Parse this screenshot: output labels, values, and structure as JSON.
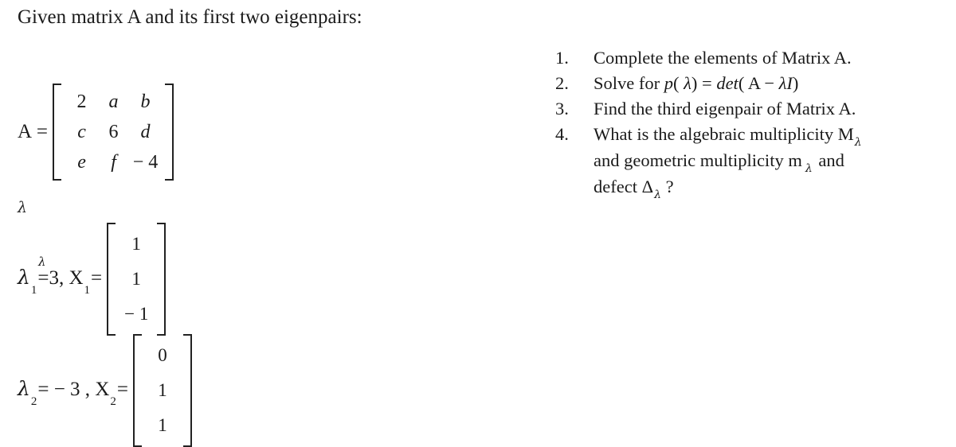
{
  "heading": "Given matrix A and its first two eigenpairs:",
  "matrix": {
    "label": "A =",
    "rows": [
      [
        "2",
        "a",
        "b"
      ],
      [
        "c",
        "6",
        "d"
      ],
      [
        "e",
        "f",
        "− 4"
      ]
    ],
    "italic_cells": [
      [
        false,
        true,
        true
      ],
      [
        true,
        false,
        true
      ],
      [
        true,
        true,
        false
      ]
    ]
  },
  "stray_symbol": "λ",
  "eigenpairs": [
    {
      "lambda_symbol": "λ",
      "index": "1",
      "overset_symbol": "λ",
      "equals": "=3,",
      "vector_label": "X",
      "vector_index": "1",
      "vector_equals": "=",
      "vector": [
        "1",
        "1",
        "− 1"
      ]
    },
    {
      "lambda_symbol": "λ",
      "index": "2",
      "overset_symbol": "",
      "equals": "= − 3 ,",
      "vector_label": "X",
      "vector_index": "2",
      "vector_equals": "=",
      "vector": [
        "0",
        "1",
        "1"
      ]
    }
  ],
  "tasks": [
    {
      "number": "1.",
      "lines": [
        [
          {
            "t": "Complete the elements of Matrix A.",
            "style": "normal"
          }
        ]
      ]
    },
    {
      "number": "2.",
      "lines": [
        [
          {
            "t": "Solve for ",
            "style": "normal"
          },
          {
            "t": "p",
            "style": "italic"
          },
          {
            "t": "( ",
            "style": "normal"
          },
          {
            "t": "λ",
            "style": "italic"
          },
          {
            "t": ") = ",
            "style": "normal"
          },
          {
            "t": "det",
            "style": "italic"
          },
          {
            "t": "( A − ",
            "style": "normal"
          },
          {
            "t": "λI",
            "style": "italic"
          },
          {
            "t": ")",
            "style": "normal"
          }
        ]
      ]
    },
    {
      "number": "3.",
      "lines": [
        [
          {
            "t": "Find the third eigenpair of Matrix A.",
            "style": "normal"
          }
        ]
      ]
    },
    {
      "number": "4.",
      "lines": [
        [
          {
            "t": "What is the algebraic multiplicity M",
            "style": "normal"
          },
          {
            "t": "λ",
            "style": "subscript"
          }
        ],
        [
          {
            "t": "and geometric multiplicity m",
            "style": "normal"
          },
          {
            "t": "λ",
            "style": "subscript-spaced"
          },
          {
            "t": " and",
            "style": "normal"
          }
        ],
        [
          {
            "t": "defect Δ",
            "style": "normal"
          },
          {
            "t": "λ",
            "style": "subscript"
          },
          {
            "t": " ?",
            "style": "normal"
          }
        ]
      ]
    }
  ],
  "colors": {
    "background": "#ffffff",
    "text": "#1a1a1a",
    "bracket": "#222222"
  }
}
